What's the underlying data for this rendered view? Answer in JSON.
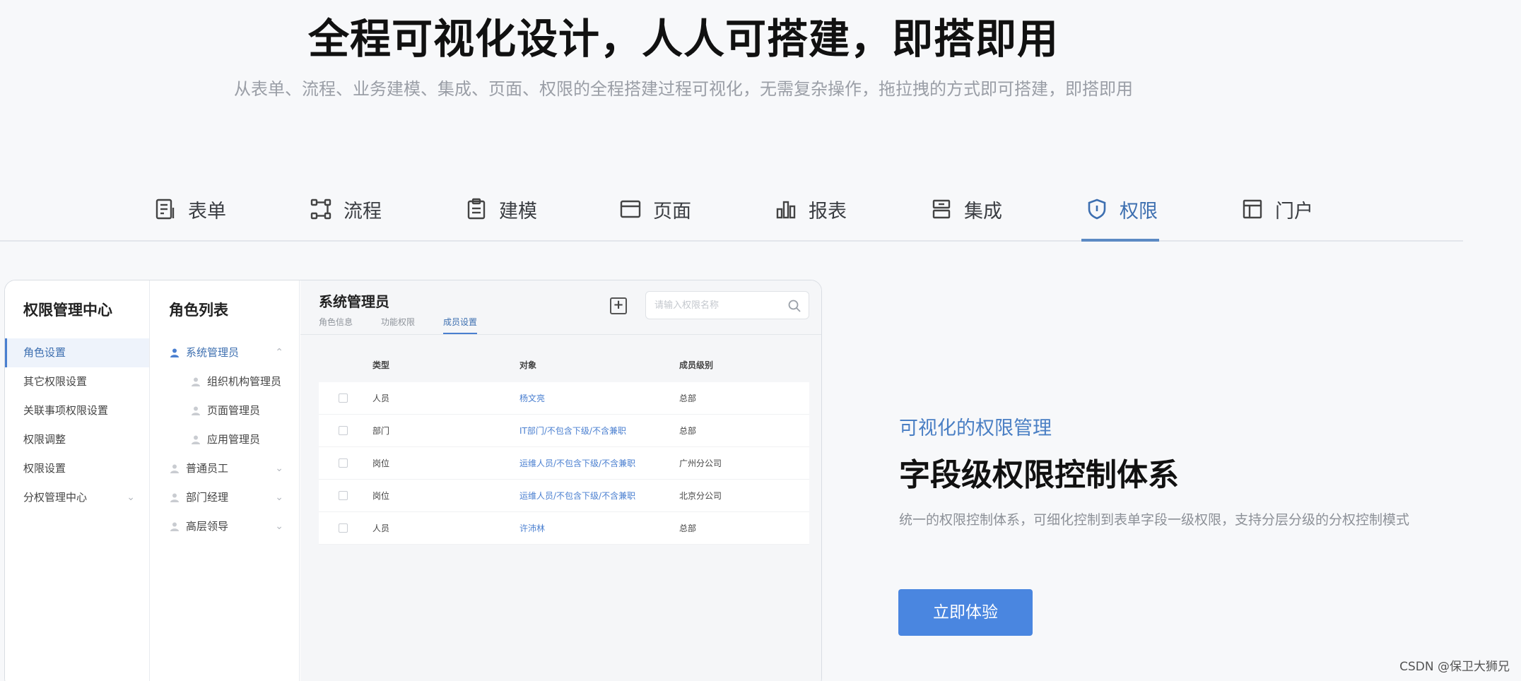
{
  "hero": {
    "title": "全程可视化设计，人人可搭建，即搭即用",
    "subtitle": "从表单、流程、业务建模、集成、页面、权限的全程搭建过程可视化，无需复杂操作，拖拉拽的方式即可搭建，即搭即用"
  },
  "tabs": [
    {
      "label": "表单",
      "icon": "form-icon"
    },
    {
      "label": "流程",
      "icon": "flow-icon"
    },
    {
      "label": "建模",
      "icon": "clipboard-icon"
    },
    {
      "label": "页面",
      "icon": "page-icon"
    },
    {
      "label": "报表",
      "icon": "bar-chart-icon"
    },
    {
      "label": "集成",
      "icon": "integration-icon"
    },
    {
      "label": "权限",
      "icon": "shield-icon"
    },
    {
      "label": "门户",
      "icon": "portal-icon"
    }
  ],
  "active_tab": "权限",
  "demo": {
    "col1": {
      "title": "权限管理中心",
      "items": [
        "角色设置",
        "其它权限设置",
        "关联事项权限设置",
        "权限调整",
        "权限设置",
        "分权管理中心"
      ]
    },
    "col2": {
      "title": "角色列表",
      "items": [
        "系统管理员",
        "组织机构管理员",
        "页面管理员",
        "应用管理员",
        "普通员工",
        "部门经理",
        "高层领导"
      ]
    },
    "col3": {
      "title": "系统管理员",
      "tabs": [
        "角色信息",
        "功能权限",
        "成员设置"
      ],
      "search_placeholder": "请输入权限名称",
      "columns": [
        "类型",
        "对象",
        "成员级别"
      ],
      "rows": [
        {
          "type": "人员",
          "object": "杨文亮",
          "level": "总部"
        },
        {
          "type": "部门",
          "object": "IT部门/不包含下级/不含兼职",
          "level": "总部"
        },
        {
          "type": "岗位",
          "object": "运维人员/不包含下级/不含兼职",
          "level": "广州分公司"
        },
        {
          "type": "岗位",
          "object": "运维人员/不包含下级/不含兼职",
          "level": "北京分公司"
        },
        {
          "type": "人员",
          "object": "许沛林",
          "level": "总部"
        }
      ]
    }
  },
  "right": {
    "kicker": "可视化的权限管理",
    "title": "字段级权限控制体系",
    "desc": "统一的权限控制体系，可细化控制到表单字段一级权限，支持分层分级的分权控制模式",
    "button": "立即体验"
  },
  "watermark": "CSDN @保卫大狮兄",
  "colors": {
    "accent": "#4a86e0",
    "active_tab": "#3d6fb0"
  }
}
